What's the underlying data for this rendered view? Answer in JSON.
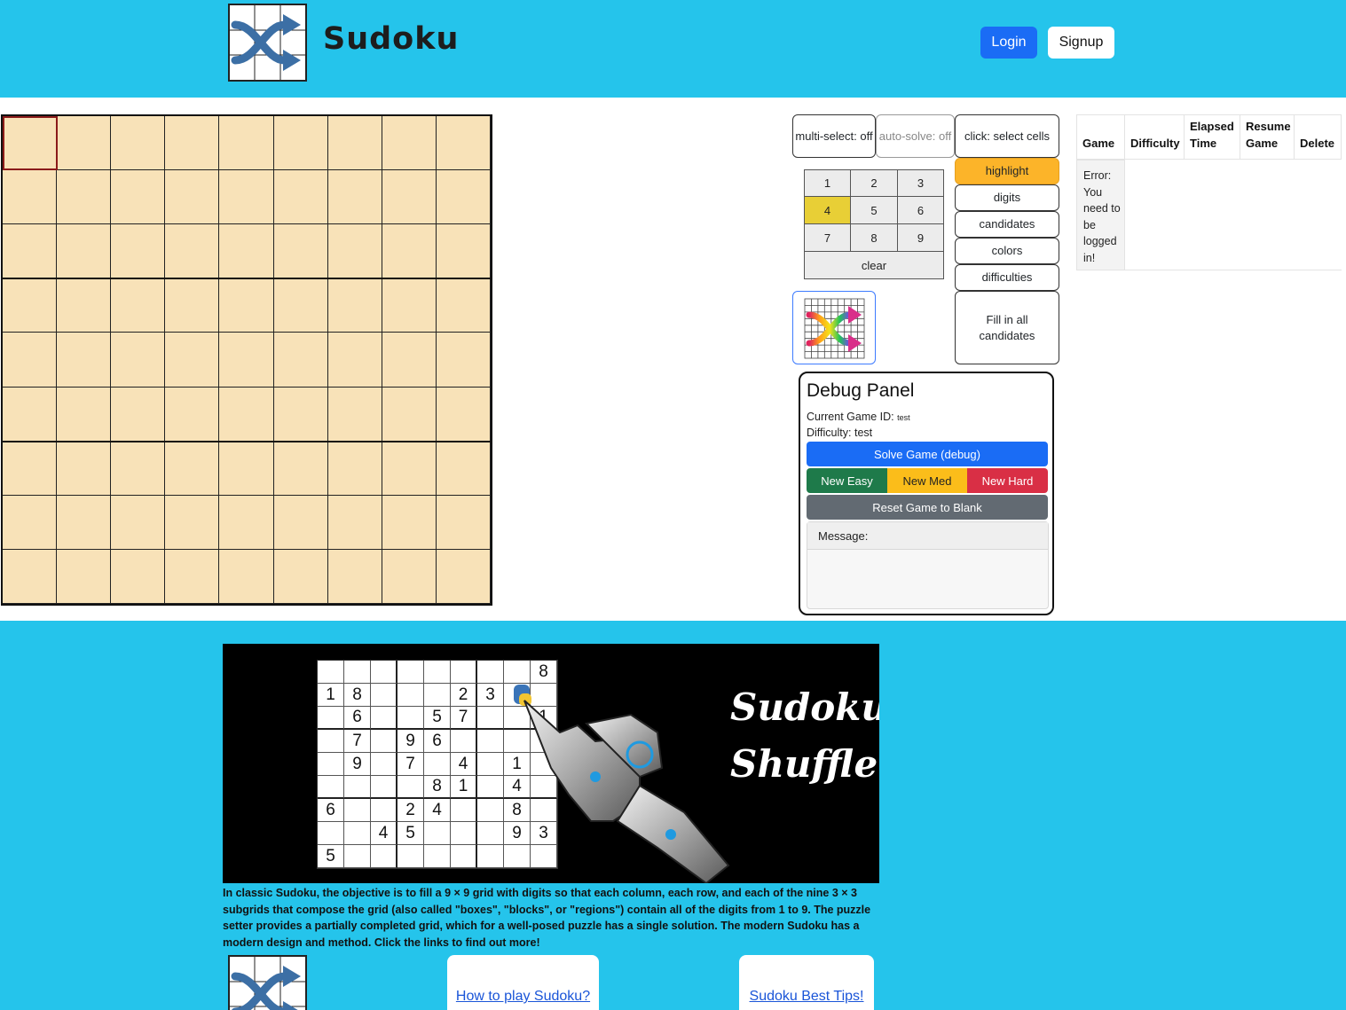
{
  "header": {
    "brand": "Sudoku",
    "login_label": "Login",
    "signup_label": "Signup"
  },
  "controls": {
    "multi_select": "multi-select: off",
    "auto_solve": "auto-solve: off",
    "click_mode": "click: select cells",
    "modes": [
      "highlight",
      "digits",
      "candidates",
      "colors",
      "difficulties"
    ],
    "active_mode": "highlight",
    "fill_candidates": "Fill in all candidates",
    "numpad": [
      "1",
      "2",
      "3",
      "4",
      "5",
      "6",
      "7",
      "8",
      "9"
    ],
    "numpad_highlighted": "4",
    "clear_label": "clear"
  },
  "debug": {
    "title": "Debug Panel",
    "game_id_label": "Current Game ID:",
    "game_id": "test",
    "difficulty_label": "Difficulty:",
    "difficulty": "test",
    "solve_label": "Solve Game (debug)",
    "new_easy": "New Easy",
    "new_med": "New Med",
    "new_hard": "New Hard",
    "reset_label": "Reset Game to Blank",
    "message_label": "Message:"
  },
  "game_table": {
    "headers": [
      "Game",
      "Difficulty",
      "Elapsed Time",
      "Resume Game",
      "Delete"
    ],
    "error": "Error: You need to be logged in!"
  },
  "banner": {
    "title_line1": "Sudoku",
    "title_line2": "Shuffle",
    "grid": [
      [
        "",
        "",
        "",
        "",
        "",
        "",
        "",
        "",
        "8"
      ],
      [
        "1",
        "8",
        "",
        "",
        "",
        "2",
        "3",
        "",
        ""
      ],
      [
        "",
        "6",
        "",
        "",
        "5",
        "7",
        "",
        "",
        "1"
      ],
      [
        "",
        "7",
        "",
        "9",
        "6",
        "",
        "",
        "",
        ""
      ],
      [
        "",
        "9",
        "",
        "7",
        "",
        "4",
        "",
        "1",
        ""
      ],
      [
        "",
        "",
        "",
        "",
        "8",
        "1",
        "",
        "4",
        ""
      ],
      [
        "6",
        "",
        "",
        "2",
        "4",
        "",
        "",
        "8",
        ""
      ],
      [
        "",
        "",
        "4",
        "5",
        "",
        "",
        "",
        "9",
        "3"
      ],
      [
        "5",
        "",
        "",
        "",
        "",
        "",
        "",
        "",
        ""
      ]
    ]
  },
  "description": "In classic Sudoku, the objective is to fill a 9 × 9 grid with digits so that each column, each row, and each of the nine 3 × 3 subgrids that compose the grid (also called \"boxes\", \"blocks\", or \"regions\") contain all of the digits from 1 to 9. The puzzle setter provides a partially completed grid, which for a well-posed puzzle has a single solution. The modern Sudoku has a modern design and method. Click the links to find out more!",
  "links": {
    "how_to": "How to play Sudoku?",
    "tips": "Sudoku Best Tips!"
  },
  "colors": {
    "header_bg": "#25c4eb",
    "board_bg": "#f8e2b8",
    "primary": "#1a6cf5",
    "highlight": "#fcb429",
    "success": "#1e7a4a",
    "warning": "#fbbd1a",
    "danger": "#d92f45",
    "secondary": "#626a72"
  }
}
